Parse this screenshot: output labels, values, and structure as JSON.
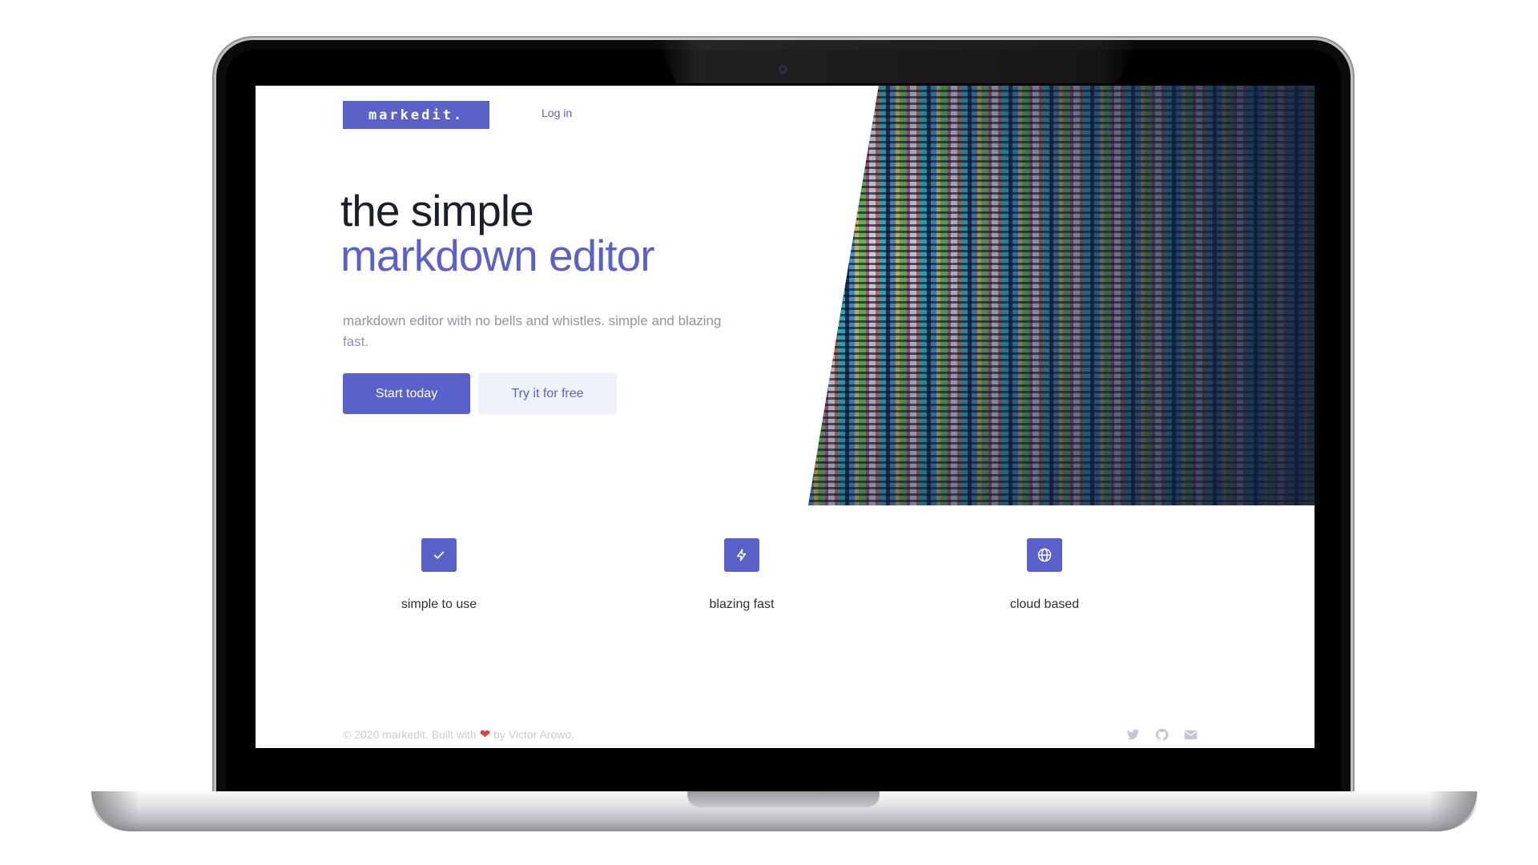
{
  "app": {
    "logo": "markedit.",
    "nav": {
      "login_label": "Log in"
    }
  },
  "hero": {
    "title_line1": "the simple",
    "title_line2": "markdown editor",
    "subtitle": "markdown editor with no bells and whistles. simple and blazing fast.",
    "primary_button": "Start today",
    "secondary_button": "Try it for free",
    "image": "code-screen-photo"
  },
  "features": [
    {
      "label": "simple to use",
      "icon": "check-icon"
    },
    {
      "label": "blazing fast",
      "icon": "lightning-icon"
    },
    {
      "label": "cloud based",
      "icon": "globe-icon"
    }
  ],
  "footer": {
    "text_before": "© 2020 markedit. Built with",
    "heart": "❤",
    "text_after": "by Victor Arowo.",
    "social_icons": [
      "twitter-icon",
      "github-icon",
      "mail-icon"
    ]
  },
  "colors": {
    "accent": "#5a62c9",
    "title": "#1b1e2b",
    "muted_text": "#8f94a6",
    "secondary_button_bg": "#eef2fc",
    "footer_text": "#c9ccd6",
    "heart": "#e23d3d"
  }
}
